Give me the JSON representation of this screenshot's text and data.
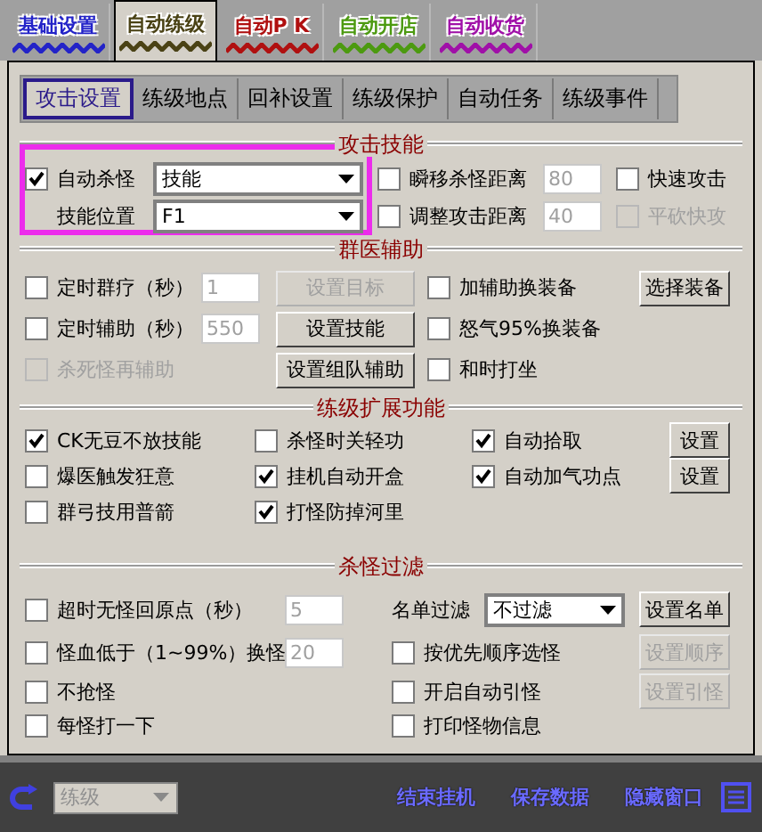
{
  "top_tabs": [
    {
      "label": "基础设置",
      "selected": false,
      "color": "#2323c8"
    },
    {
      "label": "自动练级",
      "selected": true,
      "color": "#4a4215"
    },
    {
      "label": "自动P K",
      "selected": false,
      "color": "#b01010"
    },
    {
      "label": "自动开店",
      "selected": false,
      "color": "#4c9a10"
    },
    {
      "label": "自动收货",
      "selected": false,
      "color": "#a010a8"
    }
  ],
  "sub_tabs": [
    {
      "label": "攻击设置",
      "selected": true
    },
    {
      "label": "练级地点",
      "selected": false
    },
    {
      "label": "回补设置",
      "selected": false
    },
    {
      "label": "练级保护",
      "selected": false
    },
    {
      "label": "自动任务",
      "selected": false
    },
    {
      "label": "练级事件",
      "selected": false
    }
  ],
  "sections": [
    {
      "title": "攻击技能",
      "rows": [
        [
          {
            "kind": "checkbox",
            "label": "自动杀怪",
            "checked": true,
            "disabled": false
          },
          {
            "kind": "select",
            "value": "技能"
          },
          {
            "kind": "checkbox",
            "label": "瞬移杀怪距离",
            "checked": false,
            "disabled": false
          },
          {
            "kind": "input",
            "value": "80",
            "disabled": true
          },
          {
            "kind": "checkbox",
            "label": "快速攻击",
            "checked": false,
            "disabled": false
          }
        ],
        [
          {
            "kind": "label",
            "label": "技能位置"
          },
          {
            "kind": "select",
            "value": "F1"
          },
          {
            "kind": "checkbox",
            "label": "调整攻击距离",
            "checked": false,
            "disabled": false
          },
          {
            "kind": "input",
            "value": "40",
            "disabled": true
          },
          {
            "kind": "checkbox",
            "label": "平砍快攻",
            "checked": false,
            "disabled": true
          }
        ]
      ]
    },
    {
      "title": "群医辅助",
      "rows": [
        [
          {
            "kind": "checkbox",
            "label": "定时群疗（秒）",
            "checked": false,
            "disabled": false
          },
          {
            "kind": "input",
            "value": "1",
            "disabled": true
          },
          {
            "kind": "button",
            "label": "设置目标",
            "disabled": true
          },
          {
            "kind": "checkbox",
            "label": "加辅助换装备",
            "checked": false,
            "disabled": false
          },
          {
            "kind": "button",
            "label": "选择装备",
            "disabled": false
          }
        ],
        [
          {
            "kind": "checkbox",
            "label": "定时辅助（秒）",
            "checked": false,
            "disabled": false
          },
          {
            "kind": "input",
            "value": "550",
            "disabled": true
          },
          {
            "kind": "button",
            "label": "设置技能",
            "disabled": false
          },
          {
            "kind": "checkbox",
            "label": "怒气95%换装备",
            "checked": false,
            "disabled": false
          }
        ],
        [
          {
            "kind": "checkbox",
            "label": "杀死怪再辅助",
            "checked": false,
            "disabled": true
          },
          "",
          {
            "kind": "button",
            "label": "设置组队辅助",
            "disabled": false
          },
          {
            "kind": "checkbox",
            "label": "和时打坐",
            "checked": false,
            "disabled": false
          }
        ]
      ]
    },
    {
      "title": "练级扩展功能",
      "rows": [
        [
          {
            "kind": "checkbox",
            "label": "CK无豆不放技能",
            "checked": true,
            "disabled": false
          },
          {
            "kind": "checkbox",
            "label": "杀怪时关轻功",
            "checked": false,
            "disabled": false
          },
          {
            "kind": "checkbox",
            "label": "自动拾取",
            "checked": true,
            "disabled": false
          },
          {
            "kind": "button",
            "label": "设置",
            "disabled": false
          }
        ],
        [
          {
            "kind": "checkbox",
            "label": "爆医触发狂意",
            "checked": false,
            "disabled": false
          },
          {
            "kind": "checkbox",
            "label": "挂机自动开盒",
            "checked": true,
            "disabled": false
          },
          {
            "kind": "checkbox",
            "label": "自动加气功点",
            "checked": true,
            "disabled": false
          },
          {
            "kind": "button",
            "label": "设置",
            "disabled": false
          }
        ],
        [
          {
            "kind": "checkbox",
            "label": "群弓技用普箭",
            "checked": false,
            "disabled": false
          },
          {
            "kind": "checkbox",
            "label": "打怪防掉河里",
            "checked": true,
            "disabled": false
          }
        ]
      ]
    },
    {
      "title": "杀怪过滤",
      "rows": [
        [
          {
            "kind": "checkbox",
            "label": "超时无怪回原点（秒）",
            "checked": false,
            "disabled": false
          },
          {
            "kind": "input",
            "value": "5",
            "disabled": true
          },
          {
            "kind": "label",
            "label": "名单过滤"
          },
          {
            "kind": "select",
            "value": "不过滤"
          },
          {
            "kind": "button",
            "label": "设置名单",
            "disabled": false
          }
        ],
        [
          {
            "kind": "checkbox",
            "label": "怪血低于（1~99%）换怪",
            "checked": false,
            "disabled": false
          },
          {
            "kind": "input",
            "value": "20",
            "disabled": true
          },
          {
            "kind": "checkbox",
            "label": "按优先顺序选怪",
            "checked": false,
            "disabled": false
          },
          "",
          {
            "kind": "button",
            "label": "设置顺序",
            "disabled": true
          }
        ],
        [
          {
            "kind": "checkbox",
            "label": "不抢怪",
            "checked": false,
            "disabled": false
          },
          "",
          {
            "kind": "checkbox",
            "label": "开启自动引怪",
            "checked": false,
            "disabled": false
          },
          "",
          {
            "kind": "button",
            "label": "设置引怪",
            "disabled": true
          }
        ],
        [
          {
            "kind": "checkbox",
            "label": "每怪打一下",
            "checked": false,
            "disabled": false
          },
          "",
          {
            "kind": "checkbox",
            "label": "打印怪物信息",
            "checked": false,
            "disabled": false
          }
        ]
      ]
    }
  ],
  "bottom_bar": {
    "mode_select": {
      "value": "练级",
      "disabled": true
    },
    "links": [
      "结束挂机",
      "保存数据",
      "隐藏窗口"
    ]
  }
}
